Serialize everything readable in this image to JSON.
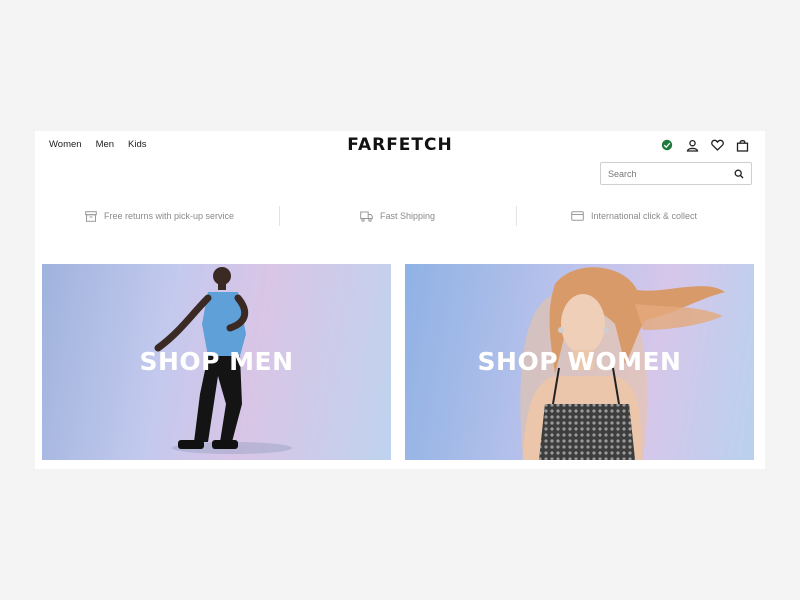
{
  "header": {
    "nav": [
      "Women",
      "Men",
      "Kids"
    ],
    "logo": "FARFETCH",
    "icons": [
      "region-icon",
      "account-icon",
      "wishlist-heart-icon",
      "shopping-bag-icon"
    ]
  },
  "search": {
    "placeholder": "Search"
  },
  "benefits": [
    {
      "icon": "returns-box-icon",
      "label": "Free returns with pick-up service"
    },
    {
      "icon": "truck-icon",
      "label": "Fast Shipping"
    },
    {
      "icon": "card-icon",
      "label": "International click & collect"
    }
  ],
  "tiles": {
    "men": {
      "label": "SHOP MEN"
    },
    "women": {
      "label": "SHOP WOMEN"
    }
  },
  "colors": {
    "region_dot": "#1e7a3c"
  }
}
